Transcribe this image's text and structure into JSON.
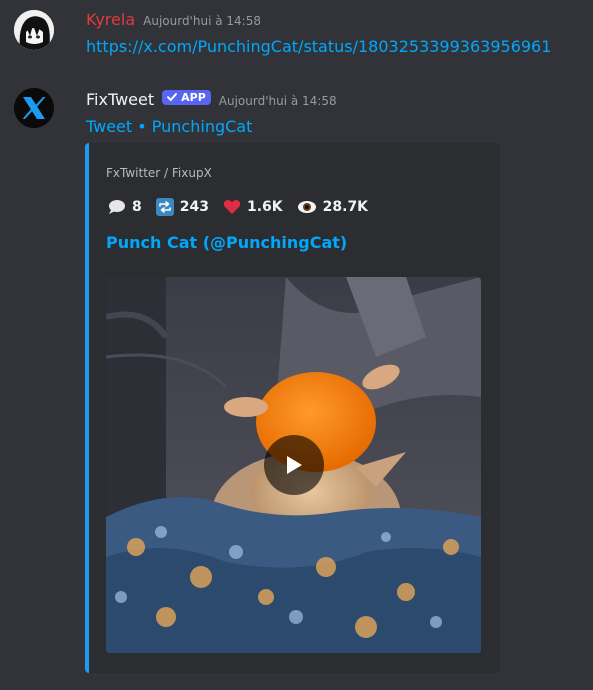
{
  "messages": [
    {
      "username": "Kyrela",
      "username_color": "#e03c3c",
      "timestamp": "Aujourd'hui à 14:58",
      "content_link": "https://x.com/PunchingCat/status/1803253399363956961",
      "avatar_icon": "anime-avatar"
    },
    {
      "username": "FixTweet",
      "username_color": "#f2f3f5",
      "badge": "APP",
      "timestamp": "Aujourd'hui à 14:58",
      "content_link": "Tweet • PunchingCat",
      "avatar_icon": "x-logo-icon",
      "embed": {
        "accent_color": "#1d9bf0",
        "provider": "FxTwitter / FixupX",
        "stats": {
          "replies": "8",
          "retweets": "243",
          "likes": "1.6K",
          "views": "28.7K"
        },
        "title": "Punch Cat (@PunchingCat)",
        "media": "video-thumbnail"
      }
    }
  ]
}
